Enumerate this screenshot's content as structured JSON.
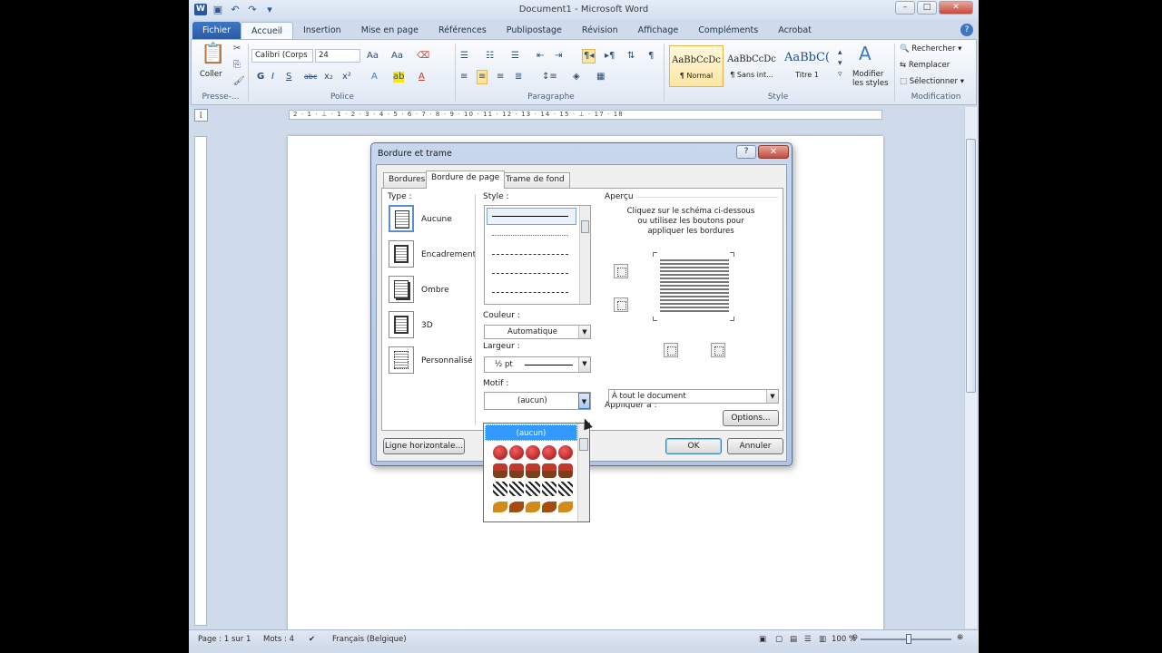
{
  "window": {
    "title": "Document1 - Microsoft Word"
  },
  "qat": {
    "undo": "↶",
    "redo": "↷"
  },
  "tabs": [
    "Fichier",
    "Accueil",
    "Insertion",
    "Mise en page",
    "Références",
    "Publipostage",
    "Révision",
    "Affichage",
    "Compléments",
    "Acrobat"
  ],
  "ribbon": {
    "clipboard": {
      "paste_label": "Coller",
      "group_label": "Presse-..."
    },
    "font": {
      "font_name": "Calibri (Corps",
      "font_size": "24",
      "group_label": "Police",
      "bold": "G",
      "italic": "I",
      "underline": "S",
      "strike": "abc",
      "sub": "x₂",
      "sup": "x²",
      "grow": "Aa"
    },
    "paragraph": {
      "group_label": "Paragraphe"
    },
    "styles": {
      "group_label": "Style",
      "modify_label_1": "Modifier",
      "modify_label_2": "les styles",
      "items": [
        {
          "preview": "AaBbCcDc",
          "name": "¶ Normal"
        },
        {
          "preview": "AaBbCcDc",
          "name": "¶ Sans int..."
        },
        {
          "preview": "AaBbC(",
          "name": "Titre 1"
        }
      ]
    },
    "editing": {
      "group_label": "Modification",
      "find": "Rechercher",
      "replace": "Remplacer",
      "select": "Sélectionner"
    }
  },
  "ruler": {
    "ticks": "2 · 1 · ⊥ · 1 · 2 · 3 · 4 · 5 · 6 · 7 · 8 · 9 · 10 · 11 · 12 · 13 · 14 · 15 · ⊥ · 17 · 18"
  },
  "dialog": {
    "title": "Bordure et trame",
    "help": "?",
    "close": "✕",
    "tabs": [
      "Bordures",
      "Bordure de page",
      "Trame de fond"
    ],
    "type_label": "Type :",
    "settings": [
      "Aucune",
      "Encadrement",
      "Ombre",
      "3D",
      "Personnalisé"
    ],
    "style_label": "Style :",
    "color_label": "Couleur :",
    "color_value": "Automatique",
    "width_label": "Largeur :",
    "width_value": "½ pt",
    "art_label": "Motif :",
    "art_value": "(aucun)",
    "preview_label": "Aperçu",
    "preview_hint_1": "Cliquez sur le schéma ci-dessous",
    "preview_hint_2": "ou utilisez les boutons pour",
    "preview_hint_3": "appliquer les bordures",
    "apply_label": "Appliquer à :",
    "apply_value": "À tout le document",
    "options_button": "Options...",
    "horizontal_line_button": "Ligne horizontale...",
    "ok_button": "OK",
    "cancel_button": "Annuler"
  },
  "art_dropdown": {
    "highlighted": "(aucun)"
  },
  "statusbar": {
    "page": "Page : 1 sur 1",
    "words": "Mots : 4",
    "language": "Français (Belgique)",
    "zoom": "100 %"
  }
}
